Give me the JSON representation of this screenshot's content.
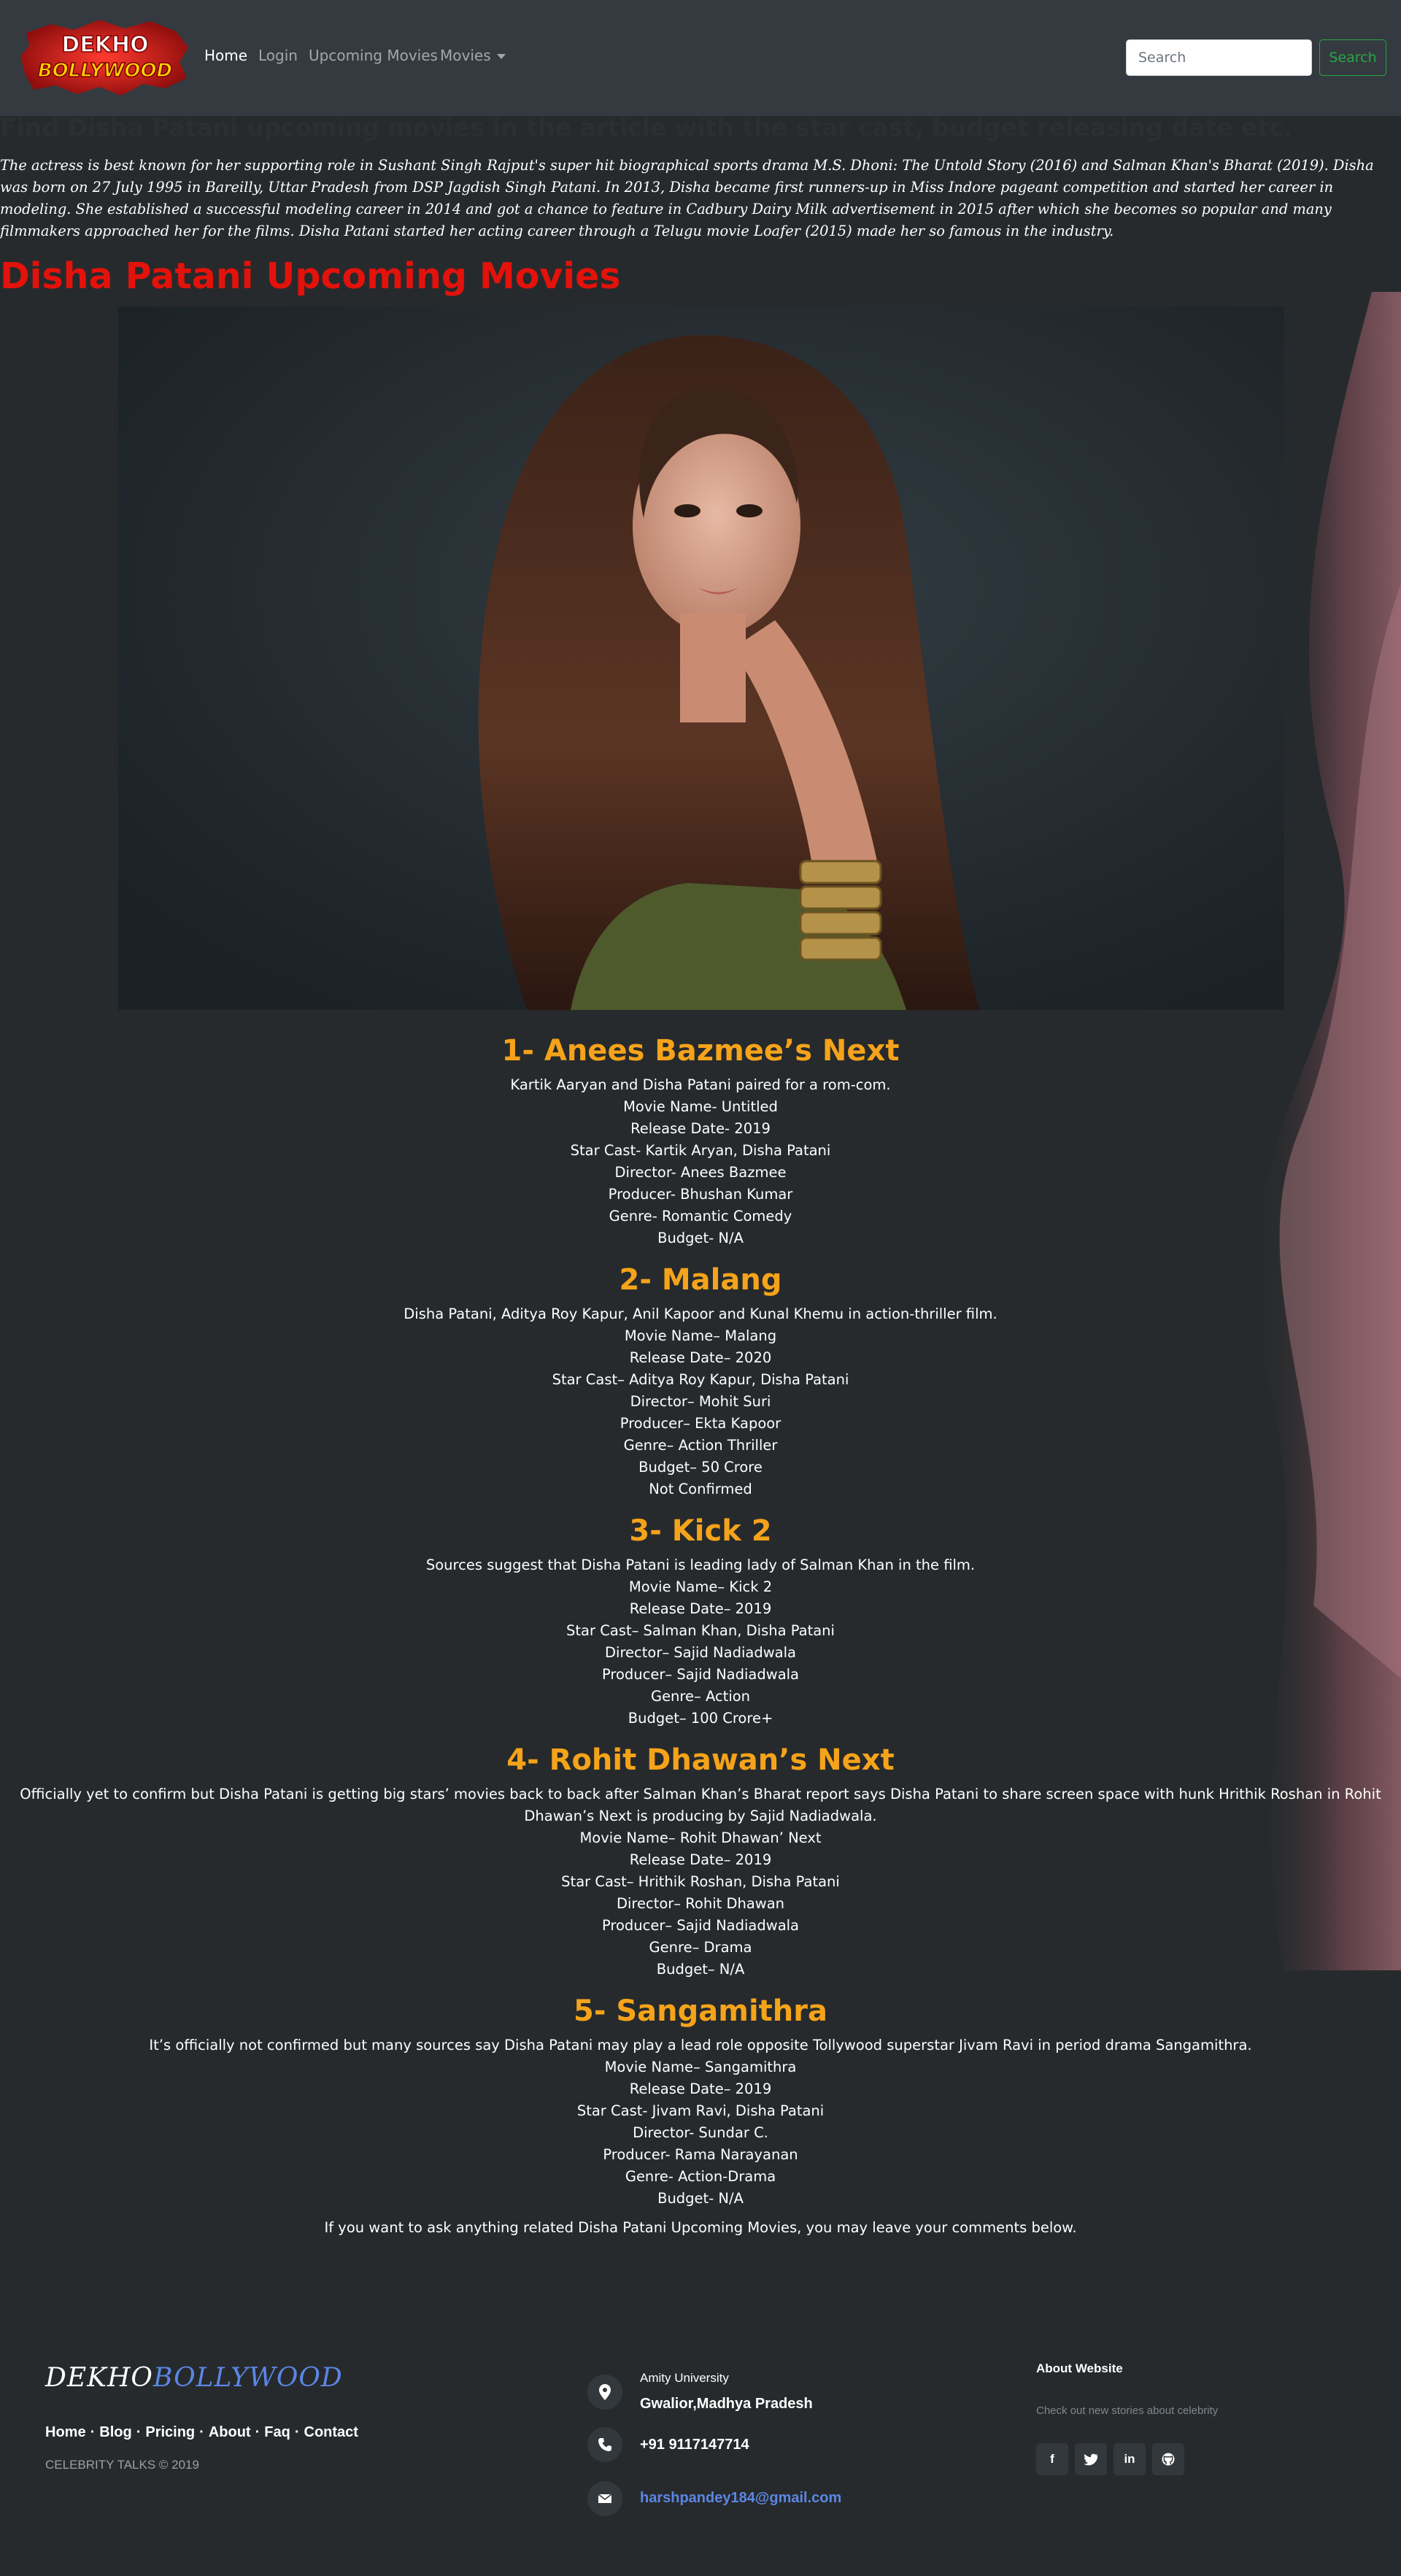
{
  "nav": {
    "logo_top": "DEKHO",
    "logo_bottom": "BOLLYWOOD",
    "links": [
      "Home",
      "Login",
      "Upcoming Movies",
      "Movies"
    ],
    "search_placeholder": "Search",
    "search_button": "Search"
  },
  "intro": {
    "heading": "Find Disha Patani upcoming movies in the article with the star cast, budget releasing date etc.",
    "paragraph": "The actress is best known for her supporting role in Sushant Singh Rajput's super hit biographical sports drama M.S. Dhoni: The Untold Story (2016) and Salman Khan's Bharat (2019). Disha was born on 27 July 1995 in Bareilly, Uttar Pradesh from DSP Jagdish Singh Patani. In 2013, Disha became first runners-up in Miss Indore pageant competition and started her career in modeling. She established a successful modeling career in 2014 and got a chance to feature in Cadbury Dairy Milk advertisement in 2015 after which she becomes so popular and many filmmakers approached her for the films. Disha Patani started her acting career through a Telugu movie Loafer (2015) made her so famous in the industry.",
    "section_title": "Disha Patani Upcoming Movies"
  },
  "movies": [
    {
      "title": "1- Anees Bazmee’s Next",
      "lines": [
        "Kartik Aaryan and Disha Patani paired for a rom-com.",
        "Movie Name- Untitled",
        "Release Date- 2019",
        "Star Cast- Kartik Aryan, Disha Patani",
        "Director- Anees Bazmee",
        "Producer- Bhushan Kumar",
        "Genre- Romantic Comedy",
        "Budget- N/A"
      ]
    },
    {
      "title": "2- Malang",
      "lines": [
        "Disha Patani, Aditya Roy Kapur, Anil Kapoor and Kunal Khemu in action-thriller film.",
        "Movie Name– Malang",
        "Release Date– 2020",
        "Star Cast– Aditya Roy Kapur, Disha Patani",
        "Director– Mohit Suri",
        "Producer– Ekta Kapoor",
        "Genre– Action Thriller",
        "Budget– 50 Crore",
        "Not Confirmed"
      ]
    },
    {
      "title": "3- Kick 2",
      "lines": [
        "Sources suggest that Disha Patani is leading lady of Salman Khan in the film.",
        "Movie Name– Kick 2",
        "Release Date– 2019",
        "Star Cast– Salman Khan, Disha Patani",
        "Director– Sajid Nadiadwala",
        "Producer– Sajid Nadiadwala",
        "Genre– Action",
        "Budget– 100 Crore+"
      ]
    },
    {
      "title": "4- Rohit Dhawan’s Next",
      "lines": [
        "Officially yet to confirm but Disha Patani is getting big stars’ movies back to back after Salman Khan’s Bharat report says Disha Patani to share screen space with hunk Hrithik Roshan in Rohit Dhawan’s Next is producing by Sajid Nadiadwala.",
        "Movie Name– Rohit Dhawan’ Next",
        "Release Date– 2019",
        "Star Cast– Hrithik Roshan, Disha Patani",
        "Director– Rohit Dhawan",
        "Producer– Sajid Nadiadwala",
        "Genre– Drama",
        "Budget– N/A"
      ]
    },
    {
      "title": "5- Sangamithra",
      "lines": [
        "It’s officially not confirmed but many sources say Disha Patani may play a lead role opposite Tollywood superstar Jivam Ravi in period drama Sangamithra.",
        "Movie Name– Sangamithra",
        "Release Date– 2019",
        "Star Cast- Jivam Ravi, Disha Patani",
        "Director- Sundar C.",
        "Producer- Rama Narayanan",
        "Genre- Action-Drama",
        "Budget- N/A"
      ]
    }
  ],
  "closing": "If you want to ask anything related Disha Patani Upcoming Movies, you may leave your comments below.",
  "footer": {
    "logo_a": "DEKHO",
    "logo_b": "BOLLYWOOD",
    "links": [
      "Home",
      "Blog",
      "Pricing",
      "About",
      "Faq",
      "Contact"
    ],
    "copyright": "CELEBRITY TALKS © 2019",
    "address_line1": "Amity University",
    "address_line2": "Gwalior,Madhya Pradesh",
    "phone": "+91 9117147714",
    "email": "harshpandey184@gmail.com",
    "about_title": "About Website",
    "about_text": "Check out new stories about celebrity",
    "social": [
      "f",
      "t",
      "in",
      "gh"
    ]
  },
  "colors": {
    "accent_red": "#e3120b",
    "accent_orange": "#f5a31a",
    "search_green": "#28a745",
    "link_blue": "#5b86e5"
  }
}
